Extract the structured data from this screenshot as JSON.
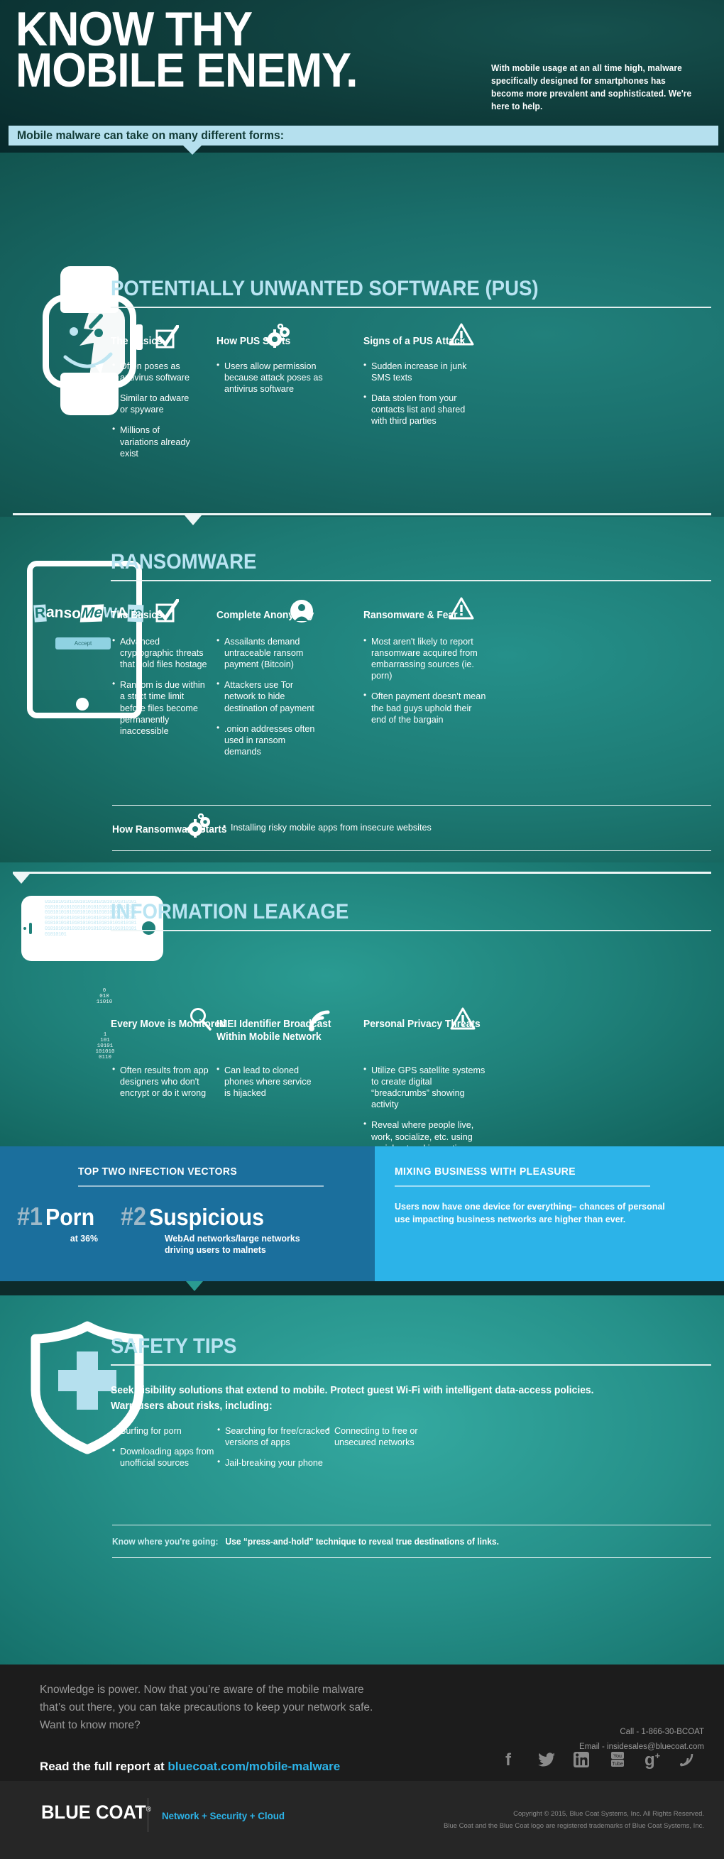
{
  "colors": {
    "hero_dark": "#0e3a39",
    "teal": "#1d7a74",
    "light_blue_bar": "#b5e0ee",
    "heading_blue": "#b9e4f2",
    "panel_dark_blue": "#1b6f9d",
    "panel_bright_blue": "#2cb3e8",
    "footer_bg": "#1c1c1c",
    "link_blue": "#2cb3e8"
  },
  "hero": {
    "title_line1": "KNOW THY",
    "title_line2": "MOBILE ENEMY.",
    "subtext": "With mobile usage at an all time high, malware specifically designed for smartphones has become more prevalent and sophisticated. We're here to help.",
    "forms_bar": "Mobile malware can take on many different forms:"
  },
  "sections": [
    {
      "id": "pus",
      "heading": "POTENTIALLY UNWANTED SOFTWARE (PUS)",
      "illustration": "smartwatch-with-face",
      "columns": [
        {
          "title": "The Basics",
          "icon": "checkbox-icon",
          "bullets": [
            "Often poses as antivirus software",
            "Similar to adware or spyware",
            "Millions of variations already exist"
          ]
        },
        {
          "title": "How PUS Starts",
          "icon": "gears-icon",
          "bullets": [
            "Users allow permission because attack poses as antivirus software"
          ]
        },
        {
          "title": "Signs of a PUS Attack",
          "icon": "warning-triangle-icon",
          "bullets": [
            "Sudden increase in junk SMS texts",
            "Data stolen from your contacts list and shared with third parties"
          ]
        }
      ]
    },
    {
      "id": "ransomware",
      "heading": "RANSOMWARE",
      "illustration": "tablet-ransom-note",
      "tablet_note": {
        "word_parts": [
          "R",
          "anso",
          "Me",
          "W",
          "A",
          "re"
        ],
        "button_label": "Accept"
      },
      "columns": [
        {
          "title": "The Basics",
          "icon": "checkbox-icon",
          "bullets": [
            "Advanced cryptographic threats that hold files hostage",
            "Ransom is due within a strict time limit before files become permanently inaccessible"
          ]
        },
        {
          "title": "Complete Anonymity",
          "icon": "user-circle-icon",
          "bullets": [
            "Assailants demand untraceable ransom payment (Bitcoin)",
            "Attackers use Tor network to hide destination of payment",
            ".onion addresses often used in ransom demands"
          ]
        },
        {
          "title": "Ransomware & Fear",
          "icon": "warning-triangle-icon",
          "bullets": [
            "Most aren't likely to report ransomware acquired from embarrassing sources (ie. porn)",
            "Often payment doesn't mean the bad guys uphold their end of the bargain"
          ]
        }
      ],
      "footer_row": {
        "title": "How Ransomware Starts",
        "icon": "gears-icon",
        "bullet": "Installing risky mobile apps from insecure websites"
      }
    },
    {
      "id": "information-leakage",
      "heading": "INFORMATION LEAKAGE",
      "illustration": "phone-binary-leak",
      "columns": [
        {
          "title": "Every Move is Monitored",
          "icon": "magnifier-icon",
          "bullets": [
            "Often results from app designers who don't encrypt or do it wrong"
          ]
        },
        {
          "title": "IMEI Identifier Broadcast Within Mobile Network",
          "icon": "signal-waves-icon",
          "bullets": [
            "Can lead to cloned phones where service is hijacked"
          ]
        },
        {
          "title": "Personal Privacy Threats",
          "icon": "warning-triangle-icon",
          "bullets": [
            "Utilize GPS satellite systems to create digital “breadcrumbs” showing activity",
            "Reveal where people live, work, socialize, etc. using social networking options"
          ]
        }
      ]
    }
  ],
  "infection_vectors": {
    "title": "TOP TWO INFECTION VECTORS",
    "items": [
      {
        "rank": "#1",
        "name": "Porn",
        "sub": "at 36%"
      },
      {
        "rank": "#2",
        "name": "Suspicious",
        "sub": "WebAd networks/large networks driving users to malnets"
      }
    ]
  },
  "mixing_panel": {
    "title": "MIXING BUSINESS WITH PLEASURE",
    "body": "Users now have one device for everything– chances of personal use impacting business networks are higher than ever."
  },
  "safety_tips": {
    "heading": "SAFETY TIPS",
    "illustration": "shield-plus-icon",
    "lede_line1": "Seek visibility solutions that extend to mobile. Protect guest Wi-Fi with intelligent data-access policies.",
    "lede_line2": "Warn users about risks, including:",
    "columns": [
      [
        "Surfing for porn",
        "Downloading apps from unofficial sources"
      ],
      [
        "Searching for free/cracked versions of apps",
        "Jail-breaking your phone"
      ],
      [
        "Connecting to free or unsecured networks"
      ]
    ],
    "note_label": "Know where you're going:",
    "note_text": "Use “press-and-hold” technique to reveal true destinations of links."
  },
  "footer": {
    "paragraph": "Knowledge is power. Now that you’re aware of the mobile malware that’s out there, you can take precautions to keep your network safe. Want to know more?",
    "read_prefix": "Read the full report at ",
    "read_link": "bluecoat.com/mobile-malware",
    "call": "Call - 1-866-30-BCOAT",
    "email": "Email - insidesales@bluecoat.com",
    "social": [
      "facebook-icon",
      "twitter-icon",
      "linkedin-icon",
      "youtube-icon",
      "googleplus-icon",
      "rss-icon"
    ],
    "logo": "BLUE COAT",
    "logo_tagline": "Network + Security + Cloud",
    "copyright_line1": "Copyright © 2015, Blue Coat Systems, Inc. All Rights Reserved.",
    "copyright_line2": "Blue Coat and the Blue Coat logo are registered trademarks of Blue Coat Systems, Inc."
  }
}
